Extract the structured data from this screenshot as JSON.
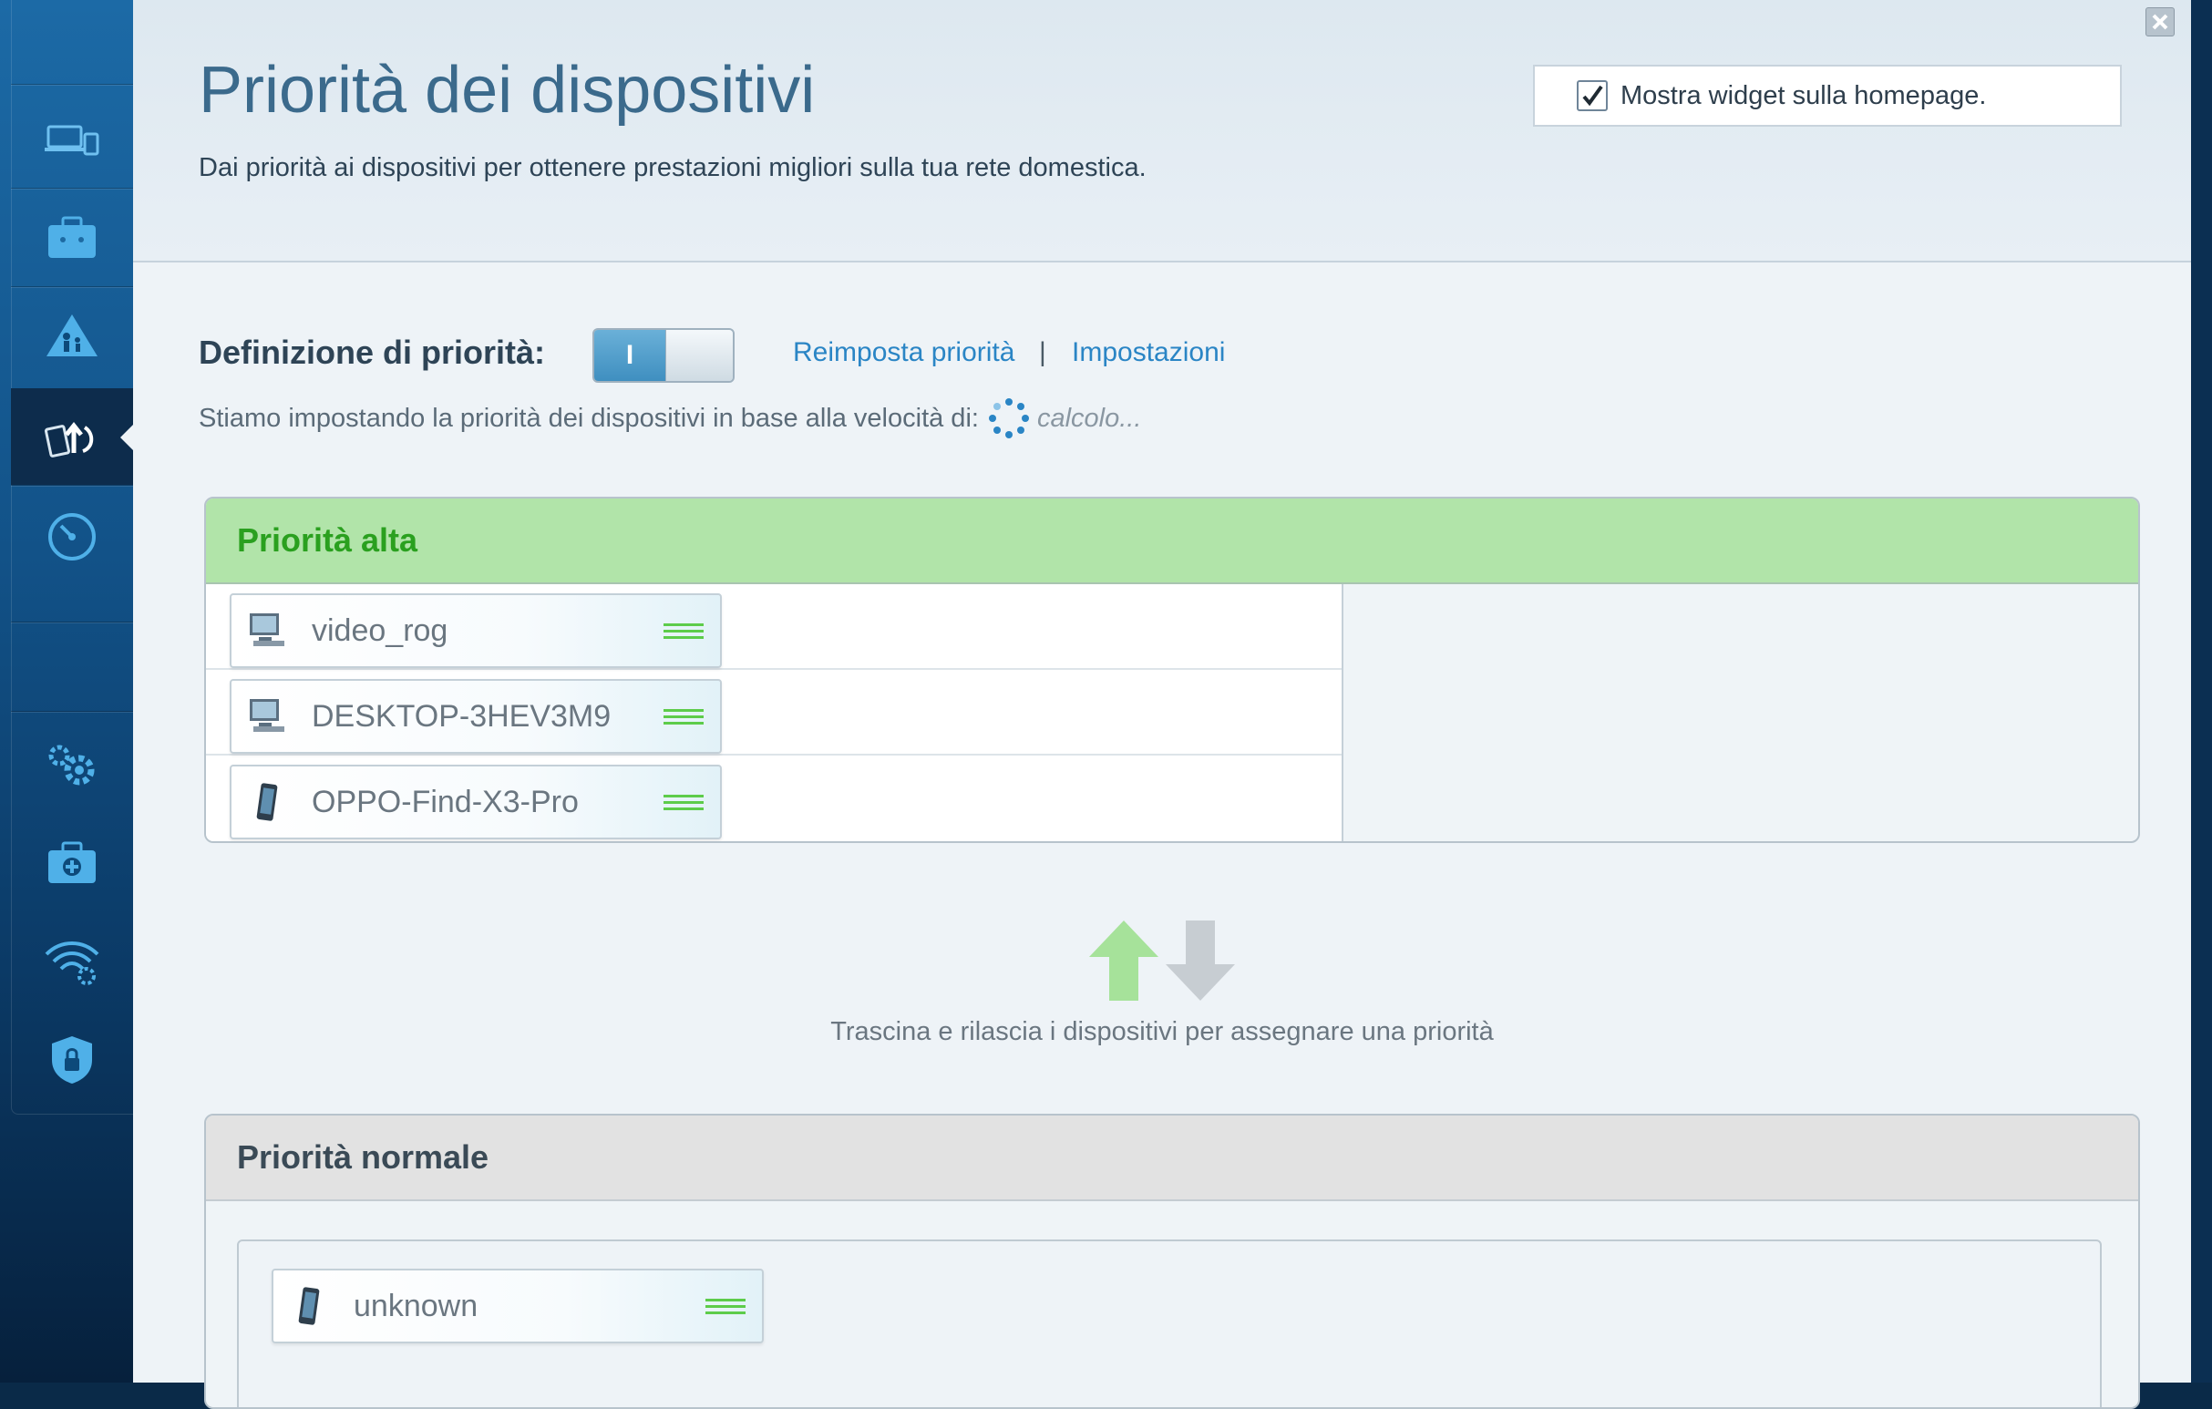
{
  "sidebar": {
    "items": [
      {
        "icon": "devices-icon"
      },
      {
        "icon": "toolbox-icon"
      },
      {
        "icon": "parental-control-icon"
      },
      {
        "icon": "media-prioritization-icon",
        "active": true
      },
      {
        "icon": "speed-test-icon"
      },
      {
        "icon": "settings-gear-icon"
      },
      {
        "icon": "troubleshooting-icon"
      },
      {
        "icon": "wifi-settings-icon"
      },
      {
        "icon": "security-shield-icon"
      }
    ]
  },
  "header": {
    "title": "Priorità dei dispositivi",
    "subtitle": "Dai priorità ai dispositivi per ottenere prestazioni migliori sulla tua rete domestica.",
    "widget_checkbox_checked": true,
    "widget_label": "Mostra widget sulla homepage."
  },
  "prioritization": {
    "label": "Definizione di priorità:",
    "toggle_on_label": "I",
    "toggle_state": "on",
    "reset_link": "Reimposta priorità",
    "separator": "|",
    "settings_link": "Impostazioni",
    "speed_text": "Stiamo impostando la priorità dei dispositivi in base alla velocità di:",
    "speed_status": "calcolo..."
  },
  "high_priority": {
    "title": "Priorità alta",
    "devices": [
      {
        "name": "video_rog",
        "icon": "desktop-computer-icon"
      },
      {
        "name": "DESKTOP-3HEV3M9",
        "icon": "desktop-computer-icon"
      },
      {
        "name": "OPPO-Find-X3-Pro",
        "icon": "mobile-phone-icon"
      }
    ]
  },
  "drag_drop": {
    "hint": "Trascina e rilascia i dispositivi per assegnare una priorità"
  },
  "normal_priority": {
    "title": "Priorità normale",
    "devices": [
      {
        "name": "unknown",
        "icon": "mobile-phone-icon"
      }
    ]
  },
  "colors": {
    "accent_link": "#2a85c5",
    "high_header_bg": "#b1e4a9",
    "high_title": "#2aa01f",
    "grip_green": "#5dcc4a"
  }
}
